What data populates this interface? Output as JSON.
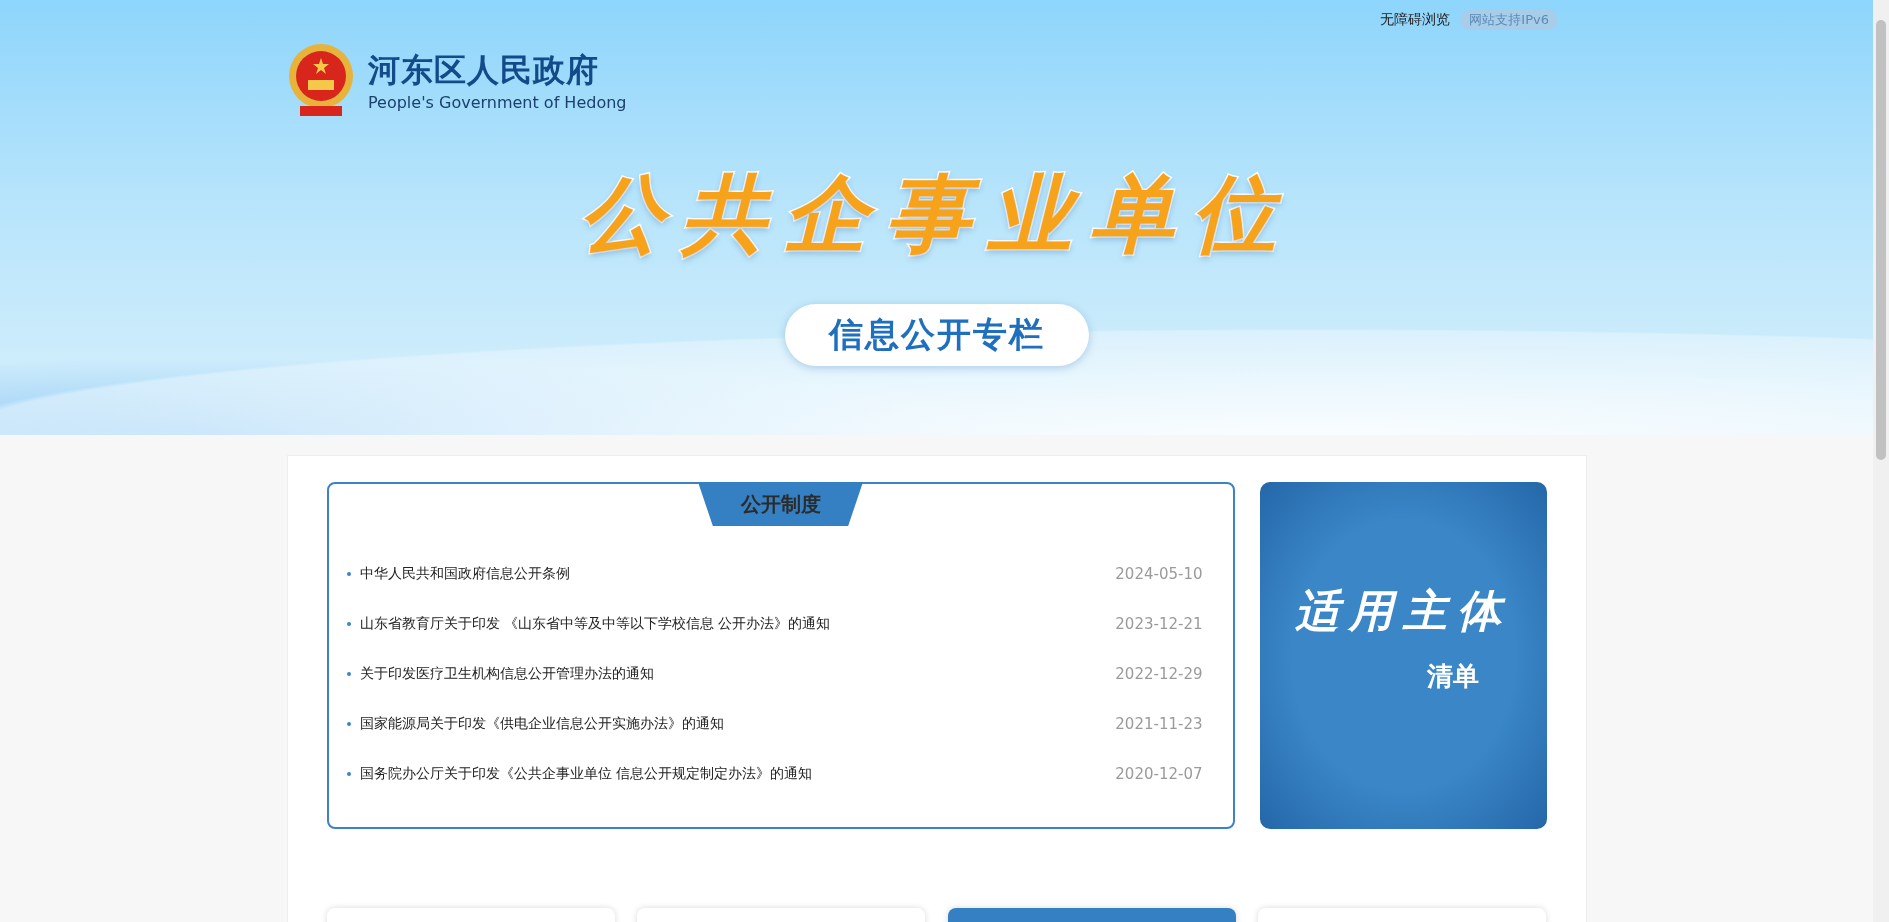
{
  "header": {
    "accessibility_link": "无障碍浏览",
    "ipv6_badge": "网站支持IPv6",
    "logo": {
      "title": "河东区人民政府",
      "subtitle": "People's Government of Hedong"
    }
  },
  "banner": {
    "title": "公共企事业单位",
    "subtitle": "信息公开专栏"
  },
  "policy_panel": {
    "title": "公开制度",
    "items": [
      {
        "title": "中华人民共和国政府信息公开条例",
        "date": "2024-05-10"
      },
      {
        "title": "山东省教育厅关于印发 《山东省中等及中等以下学校信息 公开办法》的通知",
        "date": "2023-12-21"
      },
      {
        "title": "关于印发医疗卫生机构信息公开管理办法的通知",
        "date": "2022-12-29"
      },
      {
        "title": "国家能源局关于印发《供电企业信息公开实施办法》的通知",
        "date": "2021-11-23"
      },
      {
        "title": "国务院办公厅关于印发《公共企事业单位 信息公开规定制定办法》的通知",
        "date": "2020-12-07"
      }
    ]
  },
  "subject_card": {
    "title": "适用主体",
    "subtitle": "清单"
  },
  "bottom_cards": [
    {
      "selected": false
    },
    {
      "selected": false
    },
    {
      "selected": true
    },
    {
      "selected": false
    }
  ]
}
